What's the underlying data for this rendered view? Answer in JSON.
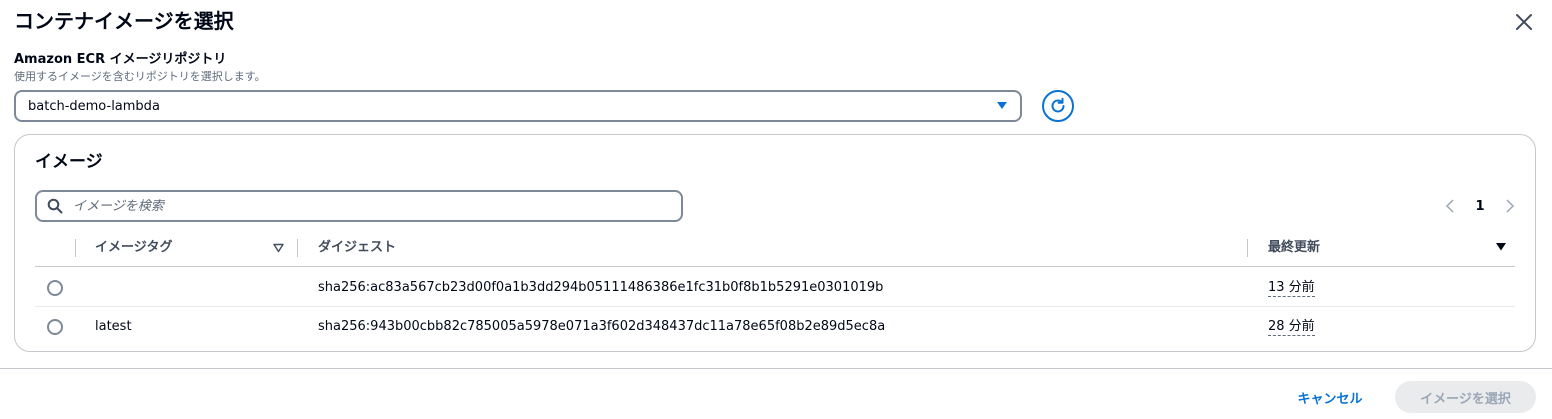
{
  "modal": {
    "title": "コンテナイメージを選択",
    "close_icon": "close-icon"
  },
  "repository": {
    "label": "Amazon ECR イメージリポジトリ",
    "description": "使用するイメージを含むリポジトリを選択します。",
    "selected_value": "batch-demo-lambda",
    "caret_icon": "caret-down-icon",
    "refresh_icon": "refresh-icon"
  },
  "images": {
    "title": "イメージ",
    "search": {
      "placeholder": "イメージを検索",
      "value": "",
      "icon": "search-icon"
    },
    "pagination": {
      "current_page": "1",
      "prev_icon": "chevron-left-icon",
      "next_icon": "chevron-right-icon"
    },
    "table": {
      "columns": [
        "イメージタグ",
        "ダイジェスト",
        "最終更新"
      ],
      "rows": [
        {
          "tag": "",
          "digest": "sha256:ac83a567cb23d00f0a1b3dd294b05111486386e1fc31b0f8b1b5291e0301019b",
          "last_updated": "13 分前"
        },
        {
          "tag": "latest",
          "digest": "sha256:943b00cbb82c785005a5978e071a3f602d348437dc11a78e65f08b2e89d5ec8a",
          "last_updated": "28 分前"
        }
      ]
    }
  },
  "footer": {
    "cancel_label": "キャンセル",
    "select_label": "イメージを選択"
  },
  "colors": {
    "accent": "#0972d3",
    "text": "#000716",
    "secondary_text": "#5f6b7a",
    "border": "#7d8998",
    "disabled_bg": "#e9ebed",
    "disabled_text": "#9ba7b6"
  }
}
